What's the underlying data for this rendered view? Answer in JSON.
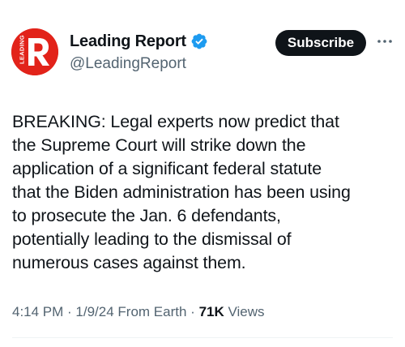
{
  "author": {
    "display_name": "Leading Report",
    "handle": "@LeadingReport",
    "avatar_text": "LEADING",
    "verified": true,
    "avatar_color": "#e2231a",
    "verified_color": "#1d9bf0"
  },
  "actions": {
    "subscribe_label": "Subscribe",
    "more_icon": "more-dots-icon"
  },
  "tweet": {
    "text": "BREAKING: Legal experts now predict that\nthe Supreme Court will strike down the\napplication of a significant federal statute\nthat the Biden administration has been using\nto prosecute the Jan. 6 defendants,\npotentially leading to the dismissal of\nnumerous cases against them."
  },
  "meta": {
    "time": "4:14 PM",
    "separator": " · ",
    "date": "1/9/24",
    "source": "From Earth",
    "views_count": "71K",
    "views_label": "Views"
  }
}
